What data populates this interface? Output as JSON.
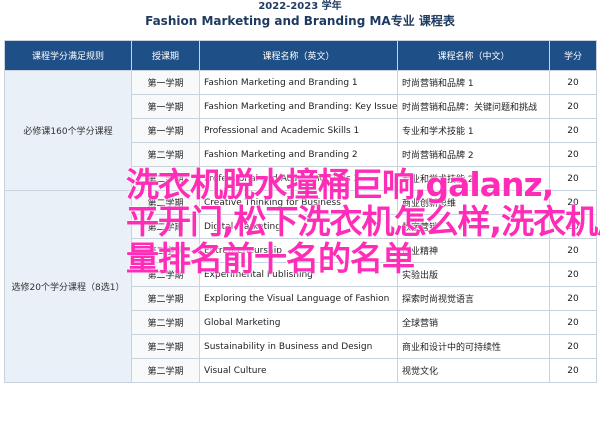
{
  "header": {
    "line1": "2022-2023 学年",
    "line2": "Fashion Marketing and Branding MA专业 课程表"
  },
  "columns": {
    "category": "课程学分满足规则",
    "semester": "授课期",
    "course_en": "课程名称（英文）",
    "course_zh": "课程名称（中文）",
    "credits": "学分"
  },
  "groups": [
    {
      "label": "必修课160个学分课程",
      "rowspan": 5
    },
    {
      "label": "选修20个学分课程（8选1）",
      "rowspan": 8
    }
  ],
  "rows": [
    {
      "semester": "第一学期",
      "en": "Fashion Marketing and Branding 1",
      "zh": "时尚营销和品牌 1",
      "credits": "20"
    },
    {
      "semester": "第一学期",
      "en": "Fashion Marketing and Branding: Key Issues and Challenges",
      "zh": "时尚营销和品牌：关键问题和挑战",
      "credits": "20"
    },
    {
      "semester": "第一学期",
      "en": "Professional and Academic Skills 1",
      "zh": "专业和学术技能 1",
      "credits": "20"
    },
    {
      "semester": "第二学期",
      "en": "Fashion Marketing and Branding 2",
      "zh": "时尚营销和品牌 2",
      "credits": "20"
    },
    {
      "semester": "第二学期",
      "en": "Professional and Academic Skills 2",
      "zh": "专业和学术技能 2",
      "credits": "20"
    },
    {
      "semester": "第二学期",
      "en": "Creative Thinking for Business",
      "zh": "商业创新思维",
      "credits": "20"
    },
    {
      "semester": "第二学期",
      "en": "Digital Marketing",
      "zh": "数字营销",
      "credits": "20"
    },
    {
      "semester": "第二学期",
      "en": "Entrepreneurship",
      "zh": "创业精神",
      "credits": "20"
    },
    {
      "semester": "第二学期",
      "en": "Experimental Publishing",
      "zh": "实验出版",
      "credits": "20"
    },
    {
      "semester": "第二学期",
      "en": "Exploring the Visual Language of Fashion",
      "zh": "探索时尚视觉语言",
      "credits": "20"
    },
    {
      "semester": "第二学期",
      "en": "Global Marketing",
      "zh": "全球营销",
      "credits": "20"
    },
    {
      "semester": "第二学期",
      "en": "Sustainability in Business and Design",
      "zh": "商业和设计中的可持续性",
      "credits": "20"
    },
    {
      "semester": "第二学期",
      "en": "Visual Culture",
      "zh": "视觉文化",
      "credits": "20"
    }
  ],
  "overlay": {
    "line1": "洗衣机脱水撞桶巨响,galanz,",
    "line2": "平开门,松下洗衣机怎么样,洗衣机质",
    "line3": "量排名前十名的名单"
  }
}
